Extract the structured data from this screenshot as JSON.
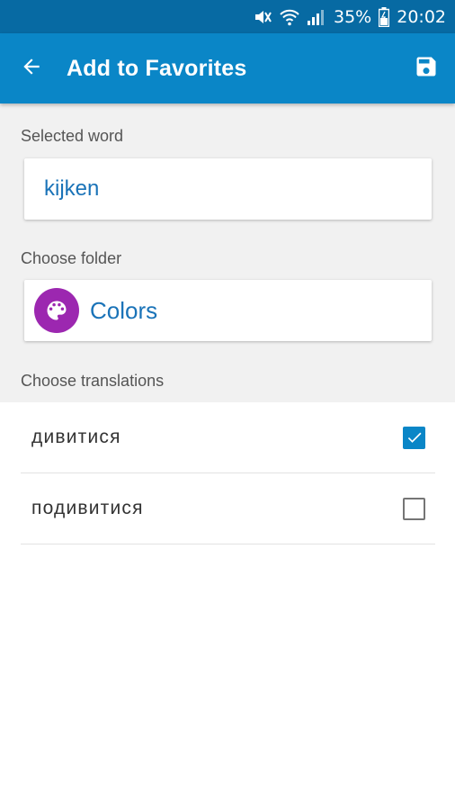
{
  "status_bar": {
    "battery": "35%",
    "time": "20:02",
    "icons": [
      "mute-icon",
      "wifi-icon",
      "signal-icon",
      "battery-icon"
    ]
  },
  "app_bar": {
    "title": "Add to Favorites",
    "back_icon": "arrow-back-icon",
    "save_icon": "save-icon",
    "background": "#0a86c7"
  },
  "form": {
    "selected_word_label": "Selected word",
    "selected_word": "kijken",
    "choose_folder_label": "Choose folder",
    "folder": {
      "name": "Colors",
      "icon": "palette-icon",
      "icon_color": "#9c27b0"
    },
    "choose_translations_label": "Choose translations"
  },
  "translations": [
    {
      "text": "дивитися",
      "checked": true
    },
    {
      "text": "подивитися",
      "checked": false
    }
  ]
}
